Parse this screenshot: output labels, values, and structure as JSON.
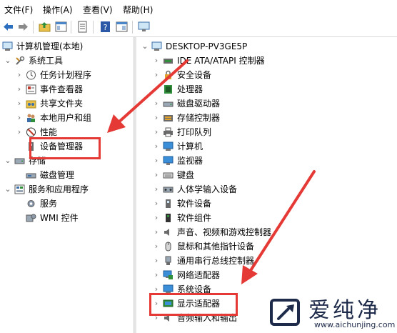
{
  "menu": {
    "file": "文件(F)",
    "action": "操作(A)",
    "view": "查看(V)",
    "help": "帮助(H)"
  },
  "left_tree": {
    "root": "计算机管理(本地)",
    "system_tools": "系统工具",
    "task_scheduler": "任务计划程序",
    "event_viewer": "事件查看器",
    "shared_folders": "共享文件夹",
    "local_users": "本地用户和组",
    "performance": "性能",
    "device_manager": "设备管理器",
    "storage": "存储",
    "disk_management": "磁盘管理",
    "services_apps": "服务和应用程序",
    "services": "服务",
    "wmi": "WMI 控件"
  },
  "right_tree": {
    "computer_name": "DESKTOP-PV3GE5P",
    "items": [
      "IDE ATA/ATAPI 控制器",
      "安全设备",
      "处理器",
      "磁盘驱动器",
      "存储控制器",
      "打印队列",
      "计算机",
      "监视器",
      "键盘",
      "人体学输入设备",
      "软件设备",
      "软件组件",
      "声音、视频和游戏控制器",
      "鼠标和其他指针设备",
      "通用串行总线控制器",
      "网络适配器",
      "系统设备",
      "显示适配器",
      "音频输入和输出"
    ]
  },
  "watermark": {
    "brand": "爱纯净",
    "url": "www.aichunjing.com"
  },
  "colors": {
    "highlight_red": "#e53935",
    "logo_blue": "#1e2a4a"
  }
}
